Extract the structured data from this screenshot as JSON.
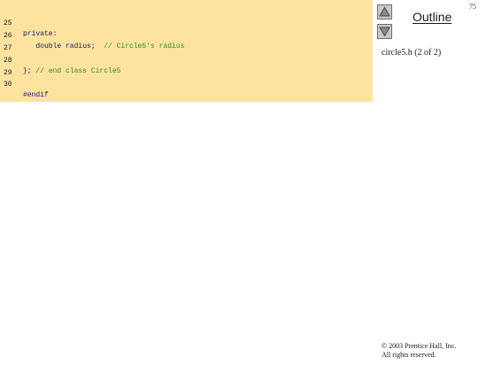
{
  "page_number": "75",
  "code": {
    "lines": [
      {
        "number": "25",
        "code": "private:",
        "comment": ""
      },
      {
        "number": "26",
        "code": "   double radius;  ",
        "comment": "// Circle5's radius"
      },
      {
        "number": "27",
        "code": "",
        "comment": ""
      },
      {
        "number": "28",
        "code": "}; ",
        "comment": "// end class Circle5"
      },
      {
        "number": "29",
        "code": "",
        "comment": ""
      },
      {
        "number": "30",
        "code": "#endif",
        "comment": ""
      }
    ]
  },
  "sidebar": {
    "outline_label": "Outline",
    "file_caption": "circle5.h (2 of 2)",
    "up_icon": "triangle-up-icon",
    "down_icon": "triangle-down-icon"
  },
  "footer": {
    "copyright_line1": "© 2003 Prentice Hall, Inc.",
    "copyright_line2": "All rights reserved."
  },
  "colors": {
    "code_background": "#fde39e",
    "comment": "#2c8a2c",
    "code_text": "#1a1a6e"
  }
}
